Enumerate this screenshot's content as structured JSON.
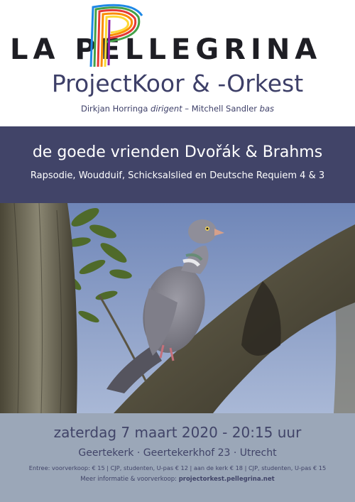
{
  "logo": {
    "name": "LA PELLEGRINA",
    "p_colors": [
      "#e53935",
      "#fb8c00",
      "#fdd835",
      "#43a047",
      "#1e88e5",
      "#8e24aa"
    ]
  },
  "header": {
    "subtitle": "ProjectKoor & -Orkest",
    "conductor_name": "Dirkjan Horringa",
    "conductor_role": "dirigent",
    "separator": "–",
    "soloist_name": "Mitchell Sandler",
    "soloist_role": "bas"
  },
  "band": {
    "title": "de goede vrienden Dvořák & Brahms",
    "program": "Rapsodie, Woudduif, Schicksalslied en Deutsche Requiem 4 & 3"
  },
  "photo": {
    "subject": "wood pigeon perched on a tree branch"
  },
  "footer": {
    "date_time": "zaterdag 7 maart 2020 - 20:15 uur",
    "venue": "Geertekerk · Geertekerkhof 23 · Utrecht",
    "prices": "Entree: voorverkoop: € 15 | CJP, studenten, U-pas € 12 | aan de kerk € 18 | CJP, studenten, U-pas € 15",
    "info_label": "Meer informatie & voorverkoop:",
    "info_url": "projectorkest.pellegrina.net"
  },
  "colors": {
    "navy": "#414468",
    "footer_bg": "#9ba7b8",
    "text_dark": "#3d3f68"
  }
}
